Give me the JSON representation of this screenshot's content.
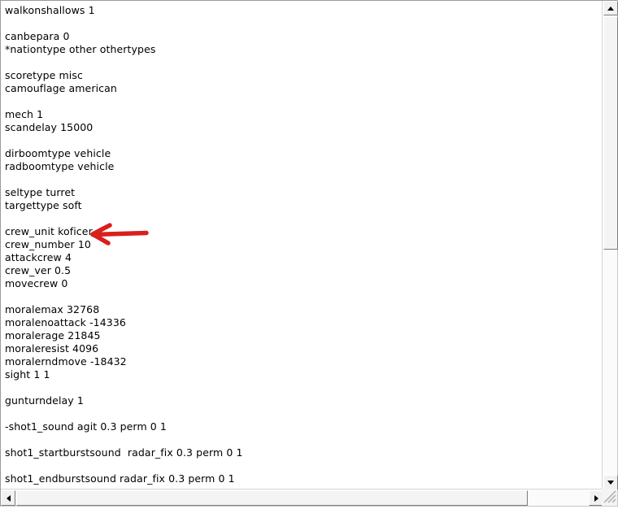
{
  "window": {
    "background_color": "#ffffff",
    "text_color": "#000000",
    "border_color": "#9a9a9a"
  },
  "document": {
    "lines": [
      "walkonshallows 1",
      "",
      "canbepara 0",
      "*nationtype other othertypes",
      "",
      "scoretype misc",
      "camouflage american",
      "",
      "mech 1",
      "scandelay 15000",
      "",
      "dirboomtype vehicle",
      "radboomtype vehicle",
      "",
      "seltype turret",
      "targettype soft",
      "",
      "crew_unit koficer",
      "crew_number 10",
      "attackcrew 4",
      "crew_ver 0.5",
      "movecrew 0",
      "",
      "moralemax 32768",
      "moralenoattack -14336",
      "moralerage 21845",
      "moraleresist 4096",
      "moralerndmove -18432",
      "sight 1 1",
      "",
      "gunturndelay 1",
      "",
      "-shot1_sound agit 0.3 perm 0 1",
      "",
      "shot1_startburstsound  radar_fix 0.3 perm 0 1",
      "",
      "shot1_endburstsound radar_fix 0.3 perm 0 1"
    ]
  },
  "annotation": {
    "type": "hand-drawn-arrow",
    "direction": "left",
    "color": "#d8201d",
    "points_at_line": "crew_unit koficer"
  },
  "scrollbars": {
    "vertical": {
      "up_button_icon": "triangle-up-icon",
      "down_button_icon": "triangle-down-icon",
      "thumb_position": "top"
    },
    "horizontal": {
      "left_button_icon": "triangle-left-icon",
      "right_button_icon": "triangle-right-icon",
      "thumb_position": "left"
    },
    "resize_grip_icon": "resize-grip-icon"
  }
}
